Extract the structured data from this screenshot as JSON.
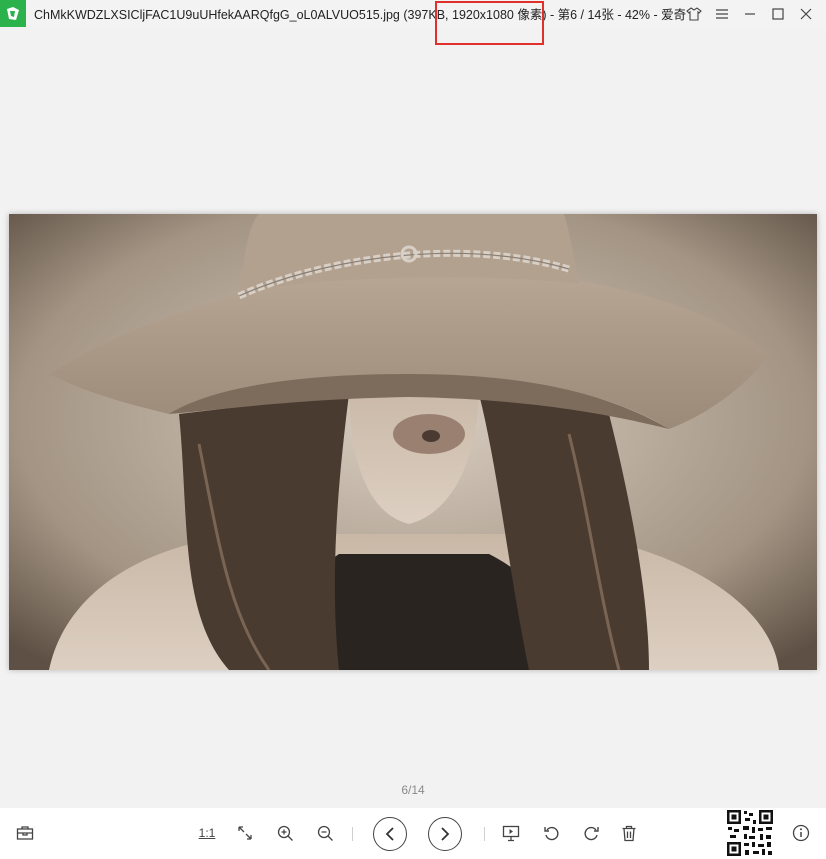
{
  "window": {
    "title": "ChMkKWDZLXSICljFAC1U9uUHfekAARQfgG_oL0ALVUO515.jpg (397KB, 1920x1080 像素) - 第6 / 14张 - 42% - 爱奇",
    "controls": [
      "skin",
      "menu",
      "minimize",
      "maximize",
      "close"
    ]
  },
  "viewer": {
    "counter": "6/14",
    "image_description_icon": "photo"
  },
  "toolbar": {
    "actual_size_label": "1:1",
    "icons": [
      "toolbox-icon",
      "fullscreen-icon",
      "zoom-in-icon",
      "zoom-out-icon",
      "prev-icon",
      "next-icon",
      "slideshow-icon",
      "rotate-left-icon",
      "rotate-right-icon",
      "delete-icon",
      "qr-code-icon",
      "info-icon"
    ]
  },
  "colors": {
    "accent": "#2bb24c",
    "annotation": "#e0302b",
    "background": "#f2f2f2"
  }
}
